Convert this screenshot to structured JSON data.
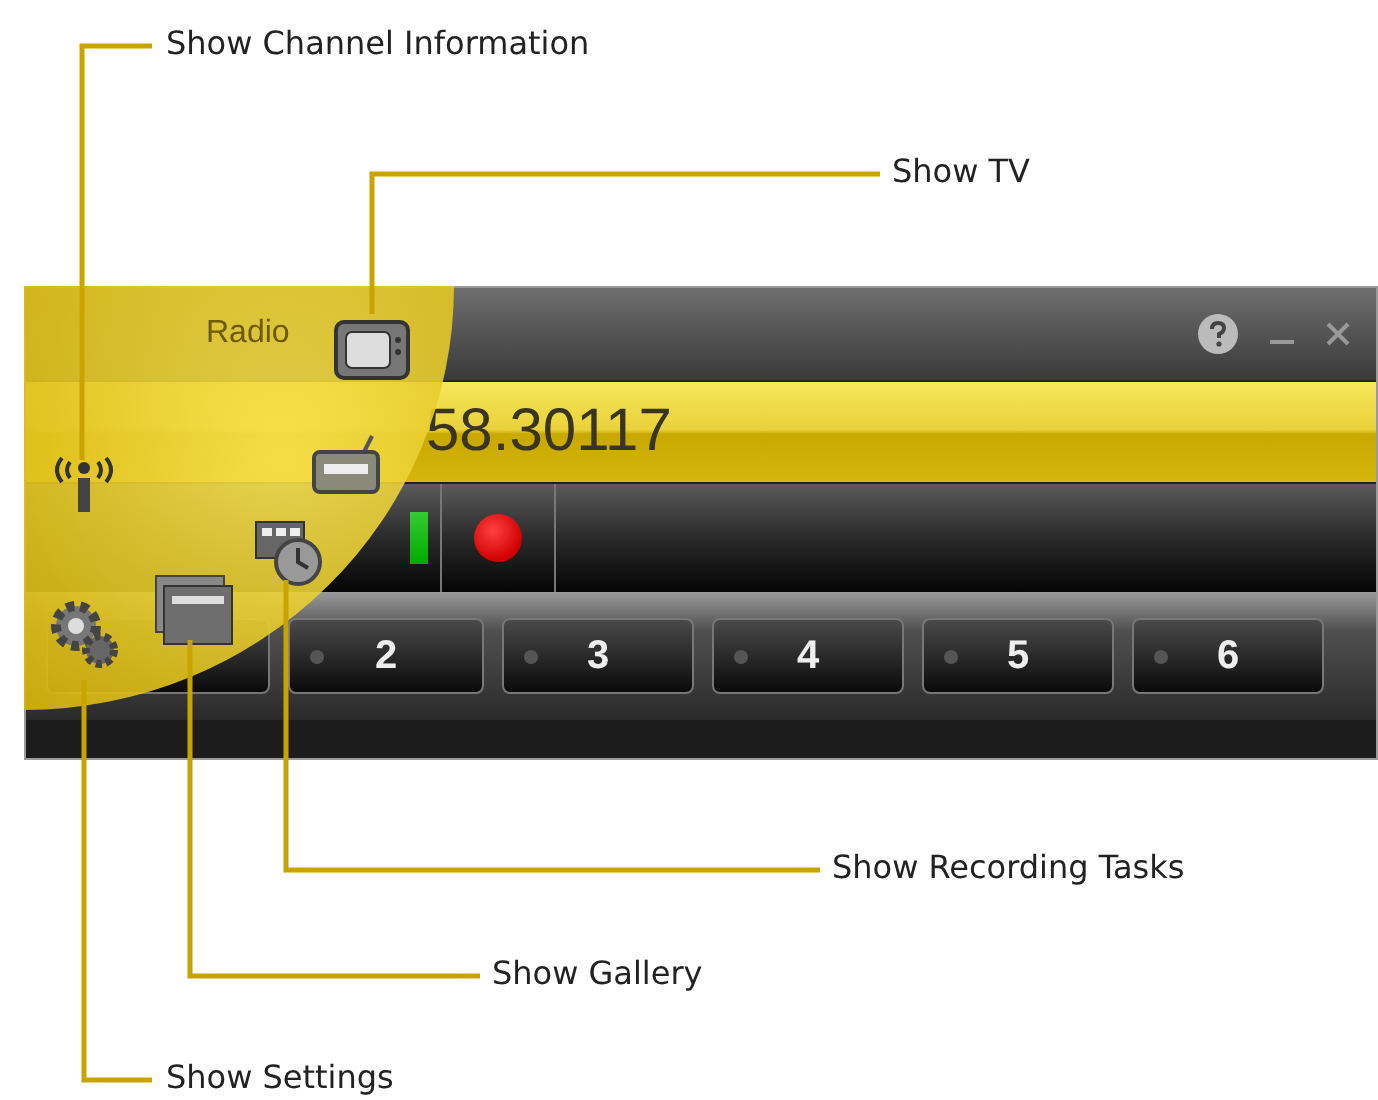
{
  "window": {
    "title": "Radio",
    "frequency": "58.30117",
    "presets": [
      {
        "label": "2"
      },
      {
        "label": "3"
      },
      {
        "label": "4"
      },
      {
        "label": "5"
      },
      {
        "label": "6"
      }
    ]
  },
  "callouts": [
    {
      "label": "Show Channel Information"
    },
    {
      "label": "Show TV"
    },
    {
      "label": "Show Recording Tasks"
    },
    {
      "label": "Show Gallery"
    },
    {
      "label": "Show Settings"
    }
  ]
}
